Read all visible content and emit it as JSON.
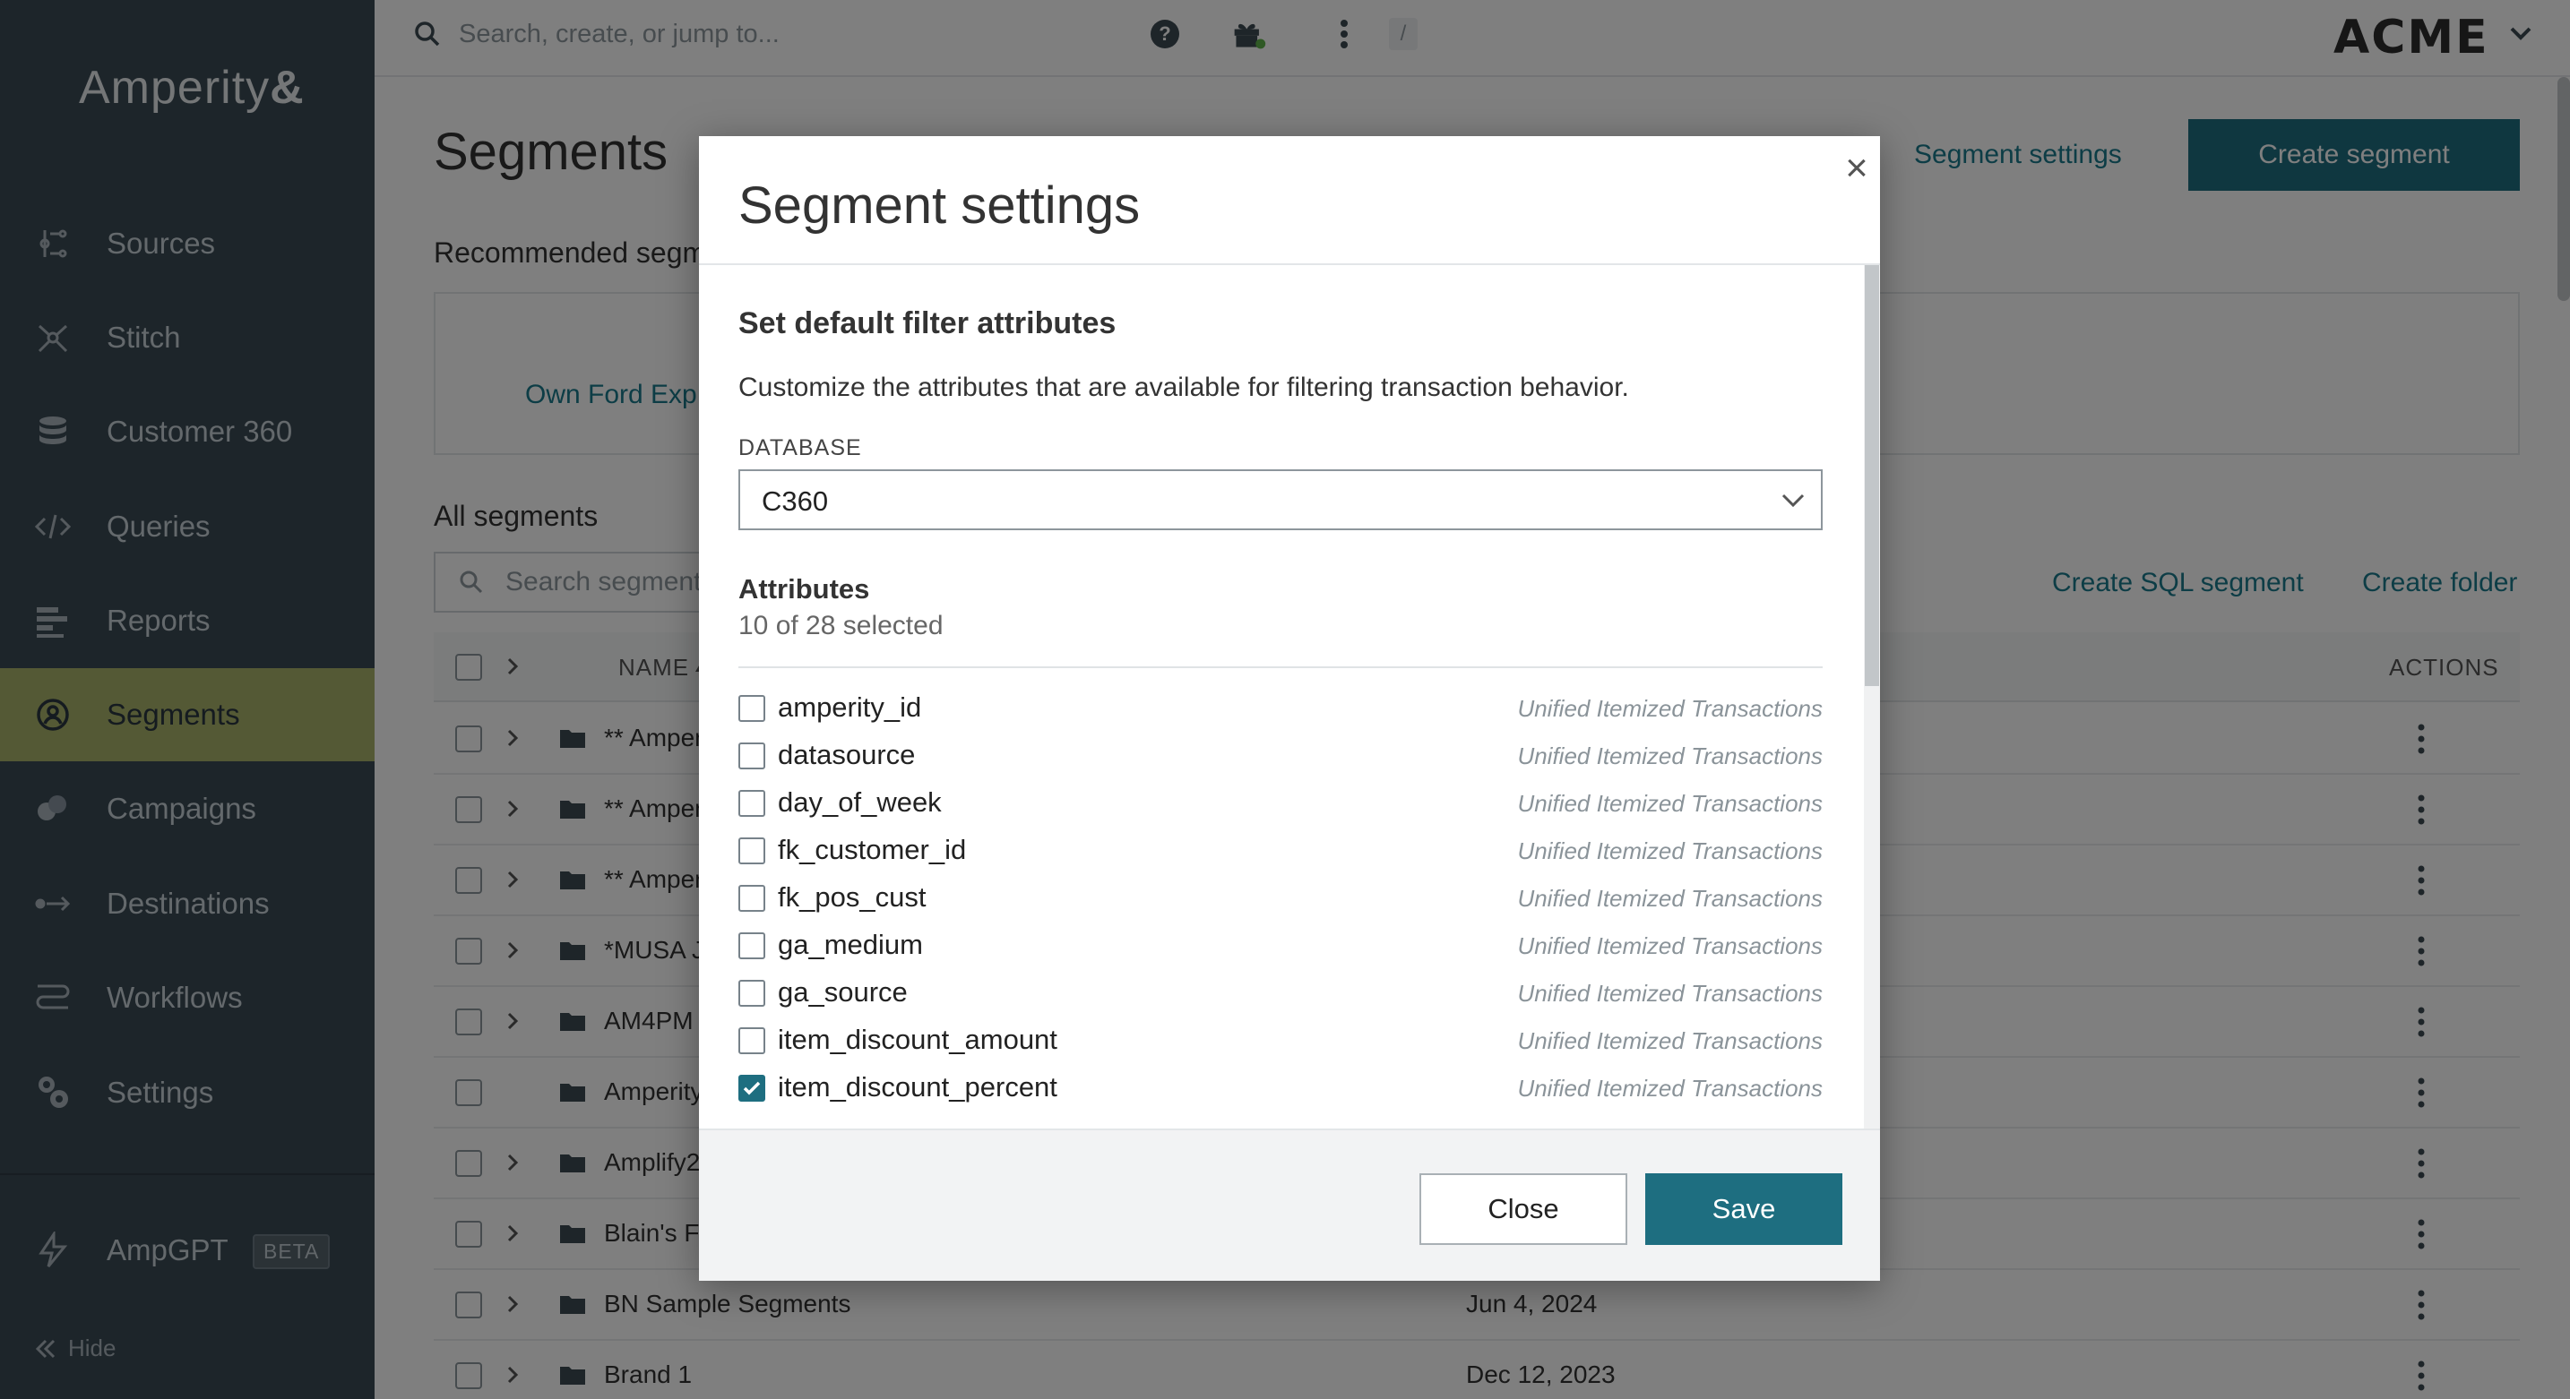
{
  "sidebar": {
    "logo": "Amperity",
    "logo_mark": "&",
    "items": [
      {
        "label": "Sources",
        "icon": "sources-icon"
      },
      {
        "label": "Stitch",
        "icon": "stitch-icon"
      },
      {
        "label": "Customer 360",
        "icon": "database-icon"
      },
      {
        "label": "Queries",
        "icon": "code-icon"
      },
      {
        "label": "Reports",
        "icon": "reports-icon"
      },
      {
        "label": "Segments",
        "icon": "segments-icon",
        "active": true
      },
      {
        "label": "Campaigns",
        "icon": "campaigns-icon"
      },
      {
        "label": "Destinations",
        "icon": "destinations-icon"
      },
      {
        "label": "Workflows",
        "icon": "workflows-icon"
      },
      {
        "label": "Settings",
        "icon": "settings-icon"
      }
    ],
    "ampgpt": {
      "label": "AmpGPT",
      "badge": "BETA"
    },
    "hide_label": "Hide"
  },
  "header": {
    "search_placeholder": "Search, create, or jump to...",
    "search_shortcut": "/",
    "tenant": "ACME"
  },
  "page": {
    "title": "Segments",
    "segment_settings_link": "Segment settings",
    "create_segment_label": "Create segment",
    "recommended_title": "Recommended segm",
    "recommended_item": "Own Ford Exp",
    "all_segments_title": "All segments",
    "segment_search_placeholder": "Search segment",
    "create_sql_label": "Create SQL segment",
    "create_folder_label": "Create folder",
    "columns": {
      "name": "NAME",
      "actions": "ACTIONS"
    },
    "rows": [
      {
        "name": "** Amper",
        "date": "",
        "expandable": true
      },
      {
        "name": "** Amper",
        "date": "",
        "expandable": true
      },
      {
        "name": "** Amper",
        "date": "",
        "expandable": true
      },
      {
        "name": "*MUSA J",
        "date": "",
        "expandable": true
      },
      {
        "name": "AM4PM",
        "date": "",
        "expandable": true
      },
      {
        "name": "Amperity",
        "date": "",
        "expandable": false
      },
      {
        "name": "Amplify2",
        "date": "",
        "expandable": true
      },
      {
        "name": "Blain's Fa",
        "date": "",
        "expandable": true
      },
      {
        "name": "BN Sample Segments",
        "date": "Jun 4, 2024",
        "expandable": true
      },
      {
        "name": "Brand 1",
        "date": "Dec 12, 2023",
        "expandable": true
      }
    ]
  },
  "modal": {
    "title": "Segment settings",
    "close_icon": "×",
    "section_title": "Set default filter attributes",
    "section_description": "Customize the attributes that are available for filtering transaction behavior.",
    "database_label": "DATABASE",
    "database_value": "C360",
    "attributes_title": "Attributes",
    "attributes_count": "10 of 28 selected",
    "attributes": [
      {
        "name": "amperity_id",
        "source": "Unified Itemized Transactions",
        "checked": false
      },
      {
        "name": "datasource",
        "source": "Unified Itemized Transactions",
        "checked": false
      },
      {
        "name": "day_of_week",
        "source": "Unified Itemized Transactions",
        "checked": false
      },
      {
        "name": "fk_customer_id",
        "source": "Unified Itemized Transactions",
        "checked": false
      },
      {
        "name": "fk_pos_cust",
        "source": "Unified Itemized Transactions",
        "checked": false
      },
      {
        "name": "ga_medium",
        "source": "Unified Itemized Transactions",
        "checked": false
      },
      {
        "name": "ga_source",
        "source": "Unified Itemized Transactions",
        "checked": false
      },
      {
        "name": "item_discount_amount",
        "source": "Unified Itemized Transactions",
        "checked": false
      },
      {
        "name": "item_discount_percent",
        "source": "Unified Itemized Transactions",
        "checked": true
      }
    ],
    "close_button": "Close",
    "save_button": "Save"
  },
  "colors": {
    "sidebar_bg": "#3a4a55",
    "sidebar_active": "#a8b26a",
    "primary": "#1e6e80",
    "link": "#1a7a8c"
  }
}
